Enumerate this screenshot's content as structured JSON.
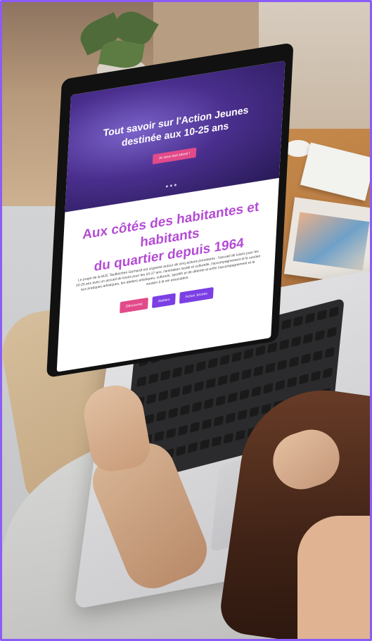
{
  "screen": {
    "hero_title_line1": "Tout savoir sur l'Action Jeunes",
    "hero_title_line2": "destinée aux 10-25 ans",
    "hero_button": "Je veux tout savoir !",
    "headline_line1": "Aux côtés des habitantes et habitants",
    "headline_line2": "du quartier depuis 1964",
    "paragraph": "Le projet de la MJC Taufkirchen Gerhardt est organisé autour de cinq actions prioritaires : l'accueil de loisirs pour les 10-25 ans avec un accueil de loisirs pour les 10-17 ans, l'animation locale et culturelle, l'accompagnement et le soutien aux pratiques artistiques, les ateliers artistiques, culturels, sportifs et de détente et enfin l'accompagnement et le soutien à la vie associative.",
    "buttons": [
      "Découvrez",
      "Ateliers",
      "Action Jeunes"
    ]
  },
  "colors": {
    "frame_border": "#8b5cf6",
    "headline": "#b44bd4",
    "button_pink": "#e24a8a",
    "button_purple": "#7b3fe4"
  }
}
